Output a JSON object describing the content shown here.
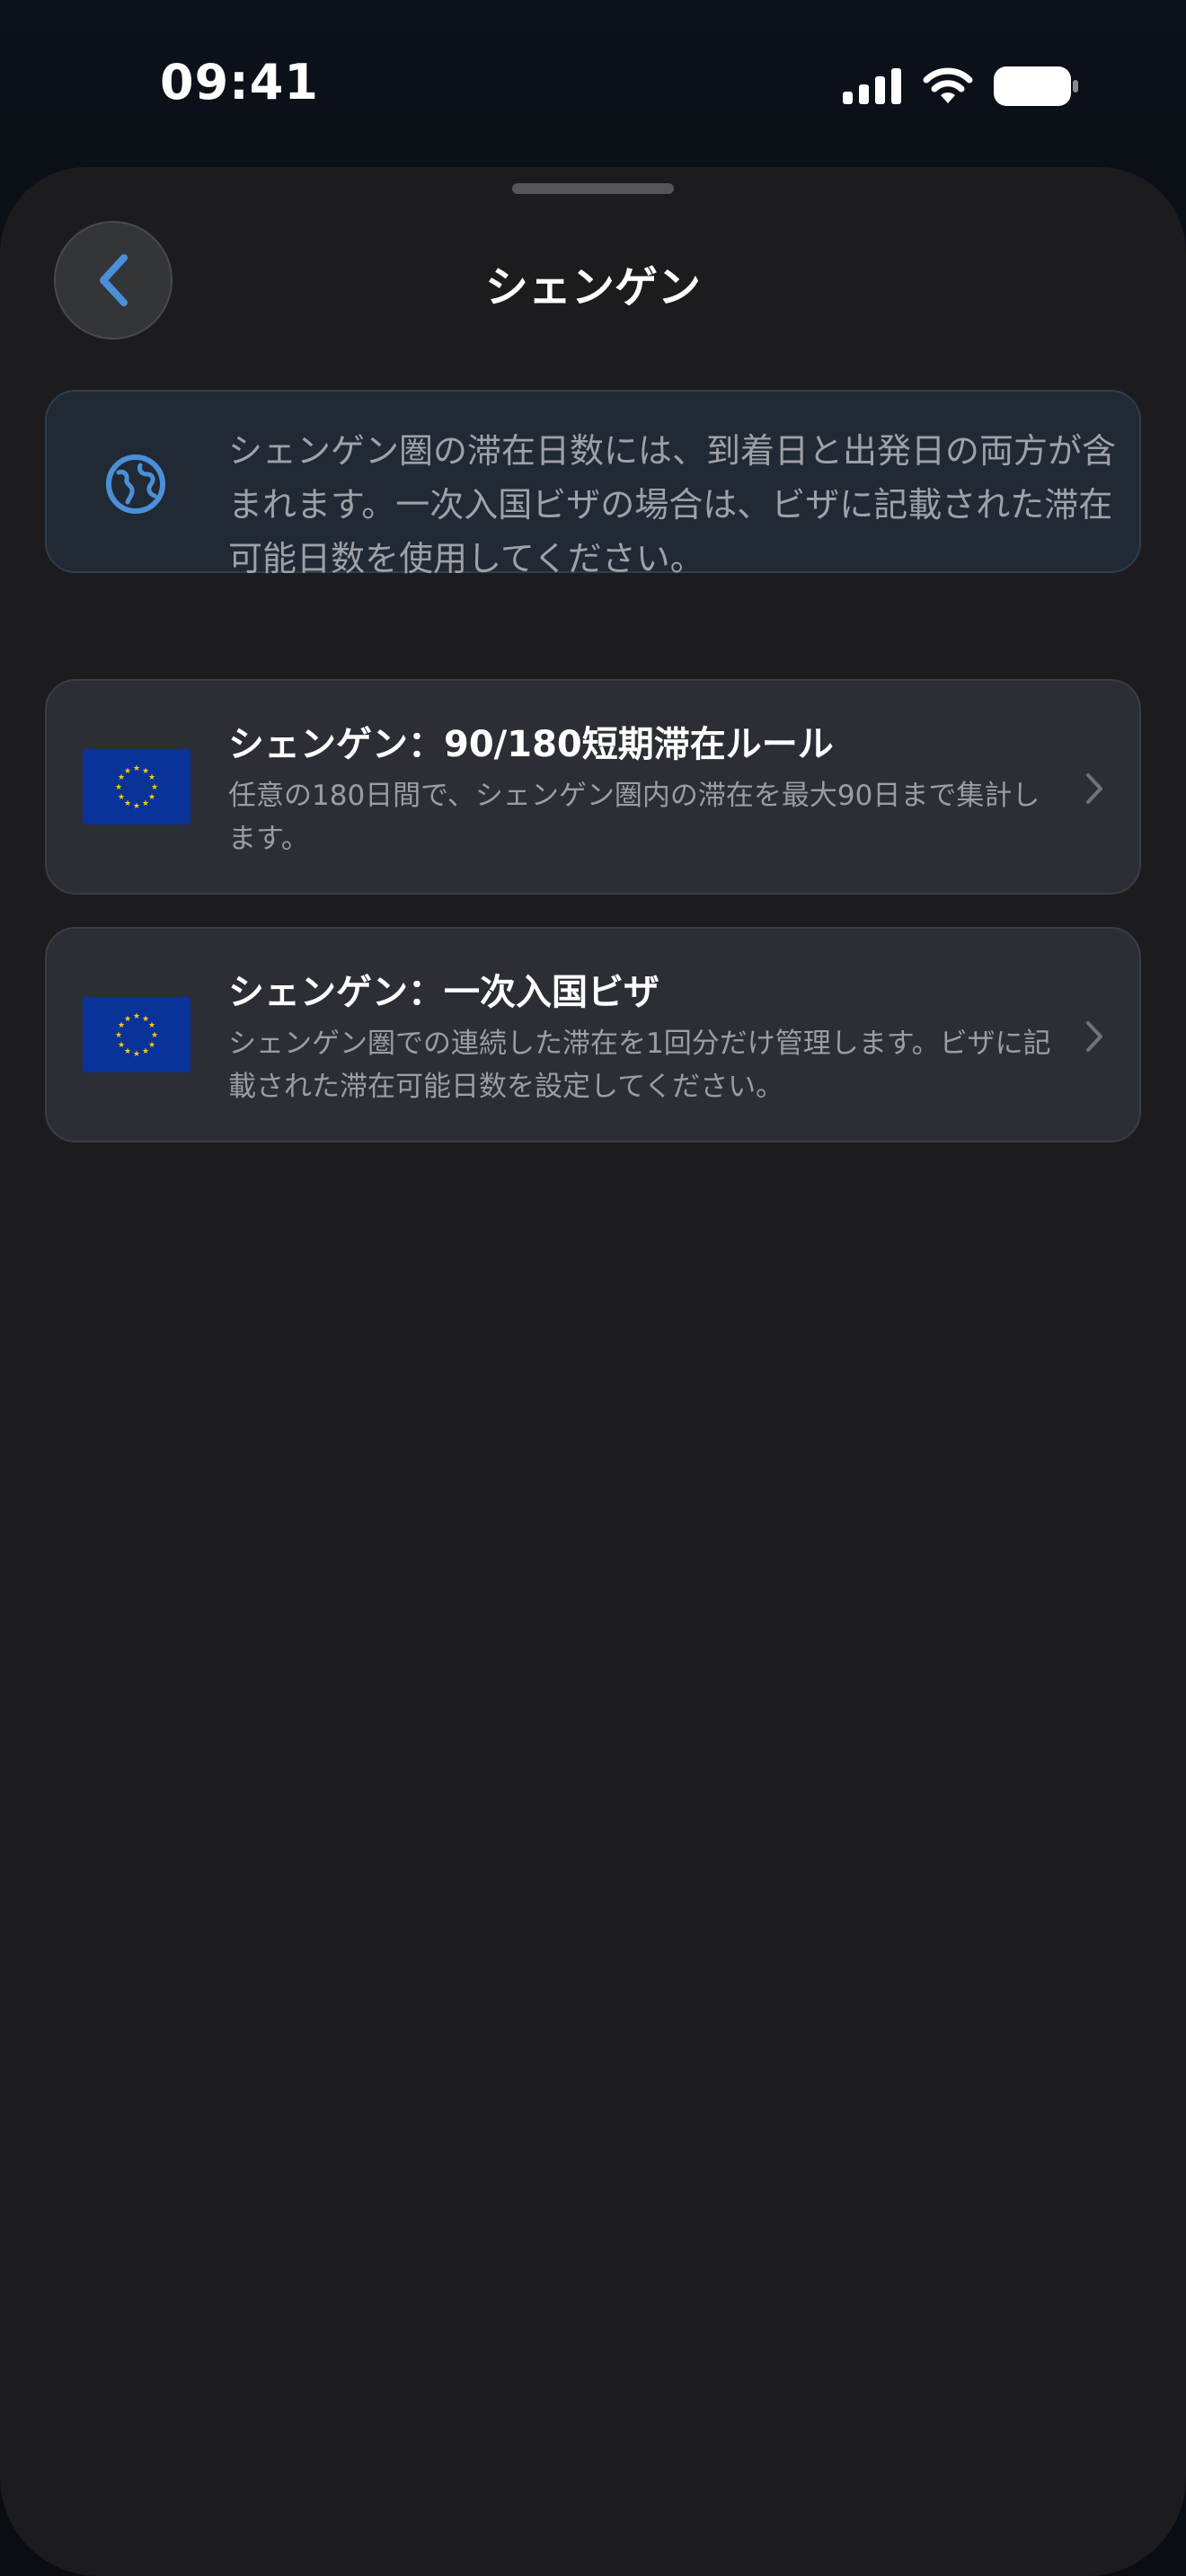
{
  "status_bar": {
    "time": "09:41",
    "icons": [
      "cellular-signal-icon",
      "wifi-icon",
      "battery-icon"
    ]
  },
  "nav": {
    "title": "シェンゲン",
    "back_icon": "chevron-left-icon"
  },
  "info": {
    "icon": "globe-icon",
    "text": "シェンゲン圏の滞在日数には、到着日と出発日の両方が含まれます。一次入国ビザの場合は、ビザに記載された滞在可能日数を使用してください。"
  },
  "rules": [
    {
      "icon": "eu-flag-icon",
      "title": "シェンゲン：90/180短期滞在ルール",
      "description": "任意の180日間で、シェンゲン圏内の滞在を最大90日まで集計します。",
      "chevron": "chevron-right-icon"
    },
    {
      "icon": "eu-flag-icon",
      "title": "シェンゲン：一次入国ビザ",
      "description": "シェンゲン圏での連続した滞在を1回分だけ管理します。ビザに記載された滞在可能日数を設定してください。",
      "chevron": "chevron-right-icon"
    }
  ],
  "colors": {
    "background": "#1c1c1e",
    "accent": "#4a90d9",
    "eu_blue": "#0a3399",
    "eu_gold": "#ffcc00"
  }
}
